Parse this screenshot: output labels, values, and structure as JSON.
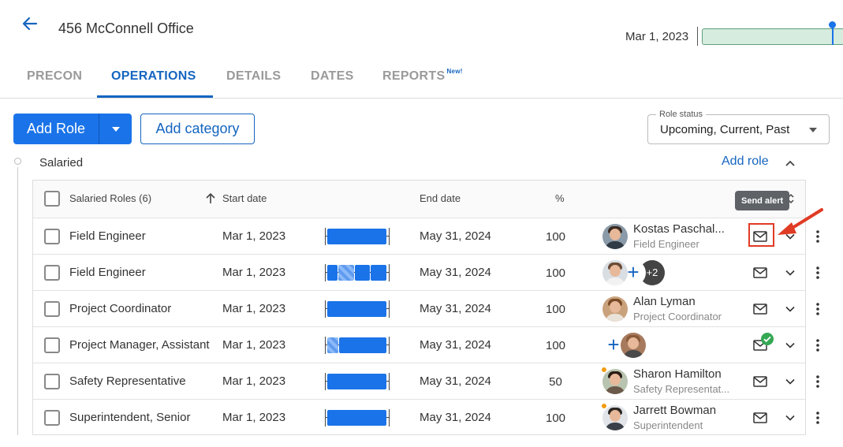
{
  "header": {
    "title": "456 McConnell Office",
    "timeline_date": "Mar 1, 2023"
  },
  "tabs": [
    {
      "label": "PRECON"
    },
    {
      "label": "OPERATIONS"
    },
    {
      "label": "DETAILS"
    },
    {
      "label": "DATES"
    },
    {
      "label": "REPORTS",
      "badge": "New!"
    }
  ],
  "toolbar": {
    "add_role_label": "Add Role",
    "add_category_label": "Add category",
    "role_status_label": "Role status",
    "role_status_value": "Upcoming, Current, Past"
  },
  "group": {
    "title": "Salaried",
    "add_role_link": "Add role"
  },
  "table": {
    "headers": {
      "roles": "Salaried Roles (6)",
      "start": "Start date",
      "end": "End date",
      "pct": "%"
    },
    "rows": [
      {
        "role": "Field Engineer",
        "start": "Mar 1, 2023",
        "end": "May 31, 2024",
        "pct": "100",
        "person": "Kostas Paschal...",
        "person_role": "Field Engineer"
      },
      {
        "role": "Field Engineer",
        "start": "Mar 1, 2023",
        "end": "May 31, 2024",
        "pct": "100",
        "more": "+2"
      },
      {
        "role": "Project Coordinator",
        "start": "Mar 1, 2023",
        "end": "May 31, 2024",
        "pct": "100",
        "person": "Alan Lyman",
        "person_role": "Project Coordinator"
      },
      {
        "role": "Project Manager, Assistant",
        "start": "Mar 1, 2023",
        "end": "May 31, 2024",
        "pct": "100"
      },
      {
        "role": "Safety Representative",
        "start": "Mar 1, 2023",
        "end": "May 31, 2024",
        "pct": "50",
        "person": "Sharon Hamilton",
        "person_role": "Safety Representat..."
      },
      {
        "role": "Superintendent, Senior",
        "start": "Mar 1, 2023",
        "end": "May 31, 2024",
        "pct": "100",
        "person": "Jarrett Bowman",
        "person_role": "Superintendent"
      }
    ]
  },
  "tooltip": "Send alert",
  "colors": {
    "accent": "#1a73e8",
    "tab_active": "#1565c0",
    "highlight": "#e03b24",
    "success": "#34a853"
  }
}
